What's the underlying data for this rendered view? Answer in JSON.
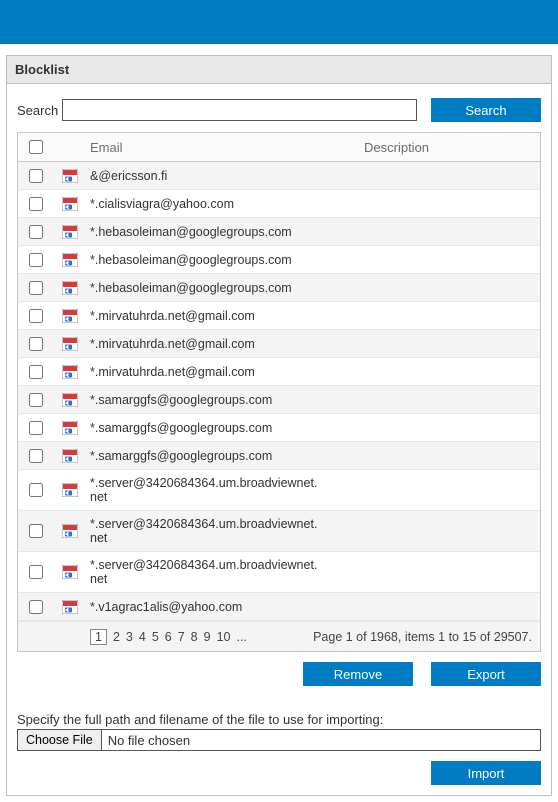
{
  "panel_title": "Blocklist",
  "search": {
    "label": "Search",
    "value": "",
    "button": "Search"
  },
  "columns": {
    "email": "Email",
    "description": "Description"
  },
  "rows": [
    {
      "email": "&@ericsson.fi",
      "description": ""
    },
    {
      "email": "*.cialisviagra@yahoo.com",
      "description": ""
    },
    {
      "email": "*.hebasoleiman@googlegroups.com",
      "description": ""
    },
    {
      "email": "*.hebasoleiman@googlegroups.com",
      "description": ""
    },
    {
      "email": "*.hebasoleiman@googlegroups.com",
      "description": ""
    },
    {
      "email": "*.mirvatuhrda.net@gmail.com",
      "description": ""
    },
    {
      "email": "*.mirvatuhrda.net@gmail.com",
      "description": ""
    },
    {
      "email": "*.mirvatuhrda.net@gmail.com",
      "description": ""
    },
    {
      "email": "*.samarggfs@googlegroups.com",
      "description": ""
    },
    {
      "email": "*.samarggfs@googlegroups.com",
      "description": ""
    },
    {
      "email": "*.samarggfs@googlegroups.com",
      "description": ""
    },
    {
      "email": "*.server@3420684364.um.broadviewnet.net",
      "description": ""
    },
    {
      "email": "*.server@3420684364.um.broadviewnet.net",
      "description": ""
    },
    {
      "email": "*.server@3420684364.um.broadviewnet.net",
      "description": ""
    },
    {
      "email": "*.v1agrac1alis@yahoo.com",
      "description": ""
    }
  ],
  "pager": {
    "pages": [
      "1",
      "2",
      "3",
      "4",
      "5",
      "6",
      "7",
      "8",
      "9",
      "10",
      "..."
    ],
    "current": "1",
    "status": "Page 1 of 1968, items 1 to 15 of 29507."
  },
  "buttons": {
    "remove": "Remove",
    "export": "Export",
    "import": "Import"
  },
  "import_section": {
    "caption": "Specify the full path and filename of the file to use for importing:",
    "choose_label": "Choose File",
    "no_file": "No file chosen"
  }
}
